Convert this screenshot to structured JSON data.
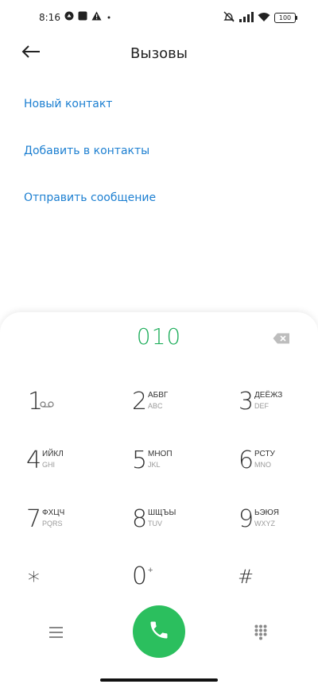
{
  "status_bar": {
    "time": "8:16",
    "battery": "100",
    "icons": [
      "app-icon",
      "app-square-icon",
      "warning-icon",
      "dot-icon",
      "mute-icon",
      "signal-icon",
      "wifi-icon",
      "battery-icon"
    ]
  },
  "header": {
    "title": "Вызовы",
    "back_icon": "arrow-left-icon"
  },
  "actions": [
    {
      "label": "Новый контакт"
    },
    {
      "label": "Добавить в контакты"
    },
    {
      "label": "Отправить сообщение"
    }
  ],
  "dialer": {
    "number": "010",
    "backspace_icon": "backspace-icon",
    "keys": [
      {
        "digit": "1",
        "letters": "",
        "latin": "",
        "icon": "voicemail-icon"
      },
      {
        "digit": "2",
        "letters": "АБВГ",
        "latin": "ABC"
      },
      {
        "digit": "3",
        "letters": "ДЕЁЖЗ",
        "latin": "DEF"
      },
      {
        "digit": "4",
        "letters": "ИЙКЛ",
        "latin": "GHI"
      },
      {
        "digit": "5",
        "letters": "МНОП",
        "latin": "JKL"
      },
      {
        "digit": "6",
        "letters": "РСТУ",
        "latin": "MNO"
      },
      {
        "digit": "7",
        "letters": "ФХЦЧ",
        "latin": "PQRS"
      },
      {
        "digit": "8",
        "letters": "ШЩЪЫ",
        "latin": "TUV"
      },
      {
        "digit": "9",
        "letters": "ЬЭЮЯ",
        "latin": "WXYZ"
      },
      {
        "digit": "∗",
        "letters": "",
        "latin": ""
      },
      {
        "digit": "0",
        "letters": "+",
        "latin": ""
      },
      {
        "digit": "#",
        "letters": "",
        "latin": ""
      }
    ],
    "bottom": {
      "menu_icon": "menu-icon",
      "call_icon": "phone-icon",
      "keypad_icon": "dialpad-icon"
    }
  },
  "colors": {
    "accent_blue": "#1c7fd1",
    "number_green": "#1fae5c",
    "call_green": "#2bbf5e"
  }
}
